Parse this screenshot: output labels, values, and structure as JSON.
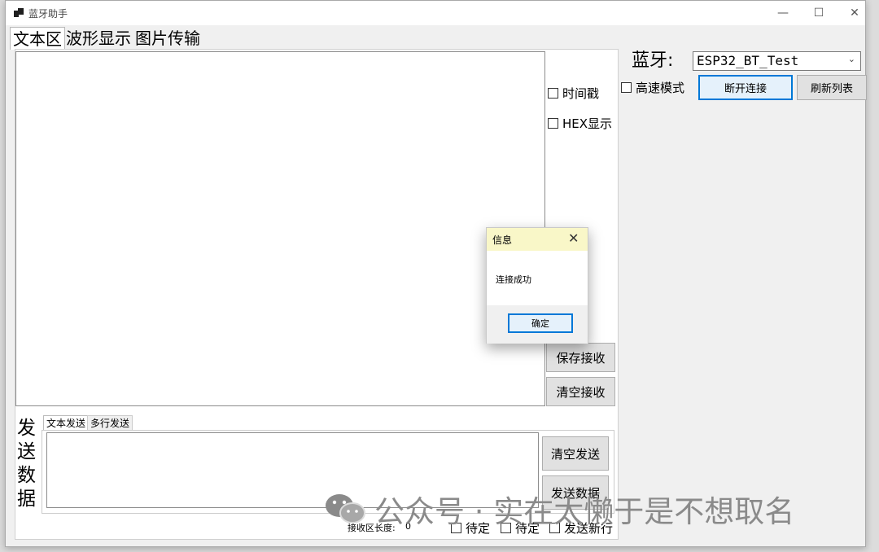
{
  "window": {
    "title": "蓝牙助手",
    "controls": [
      "—",
      "☐",
      "✕"
    ]
  },
  "tabs": [
    "文本区",
    "波形显示",
    "图片传输"
  ],
  "receive": {
    "timestamp_label": "时间戳",
    "hex_label": "HEX显示",
    "save_label": "保存接收",
    "clear_label": "清空接收",
    "length_label": "接收区长度:",
    "length_value": "0"
  },
  "bluetooth": {
    "label": "蓝牙:",
    "device": "ESP32_BT_Test",
    "highspeed_label": "高速模式",
    "disconnect_label": "断开连接",
    "refresh_label": "刷新列表"
  },
  "send": {
    "side_label": [
      "发",
      "送",
      "数",
      "据"
    ],
    "subtabs": [
      "文本发送",
      "多行发送"
    ],
    "clear_label": "清空发送",
    "send_label": "发送数据",
    "pending1_label": "待定",
    "pending2_label": "待定",
    "newline_label": "发送新行"
  },
  "dialog": {
    "title": "信息",
    "message": "连接成功",
    "ok_label": "确定"
  },
  "watermark": "公众号 · 实在太懒于是不想取名",
  "colors": {
    "dialog_title_bg": "#f9f7c8",
    "focus_blue": "#0078d7",
    "window_bg": "#f0f0f0"
  }
}
